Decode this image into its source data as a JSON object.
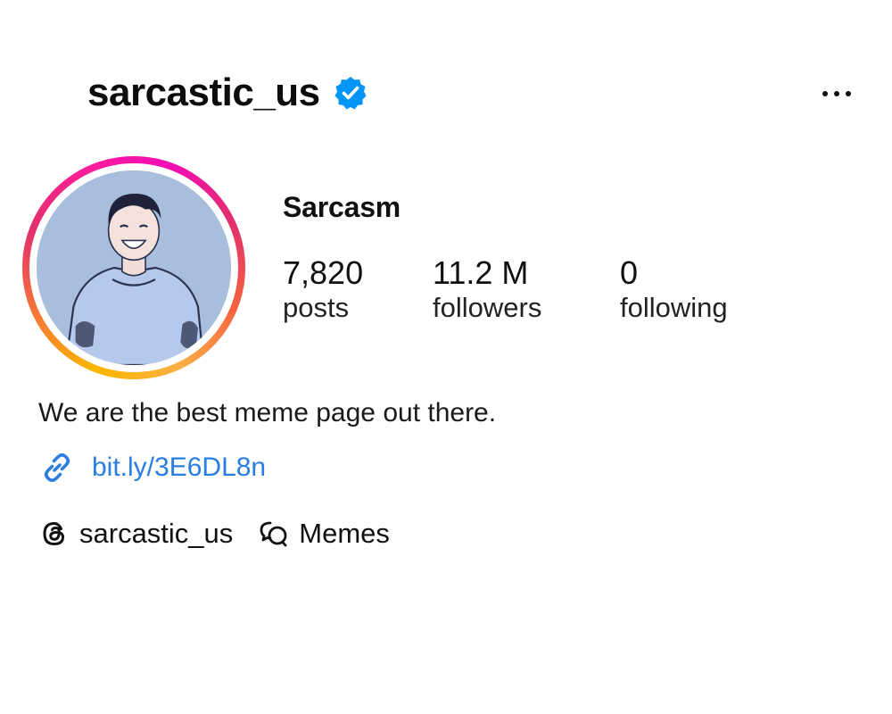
{
  "profile": {
    "username": "sarcastic_us",
    "display_name": "Sarcasm",
    "verified": true,
    "bio": "We are the best meme page out there.",
    "link": "bit.ly/3E6DL8n"
  },
  "stats": {
    "posts": {
      "value": "7,820",
      "label": "posts"
    },
    "followers": {
      "value": "11.2 M",
      "label": "followers"
    },
    "following": {
      "value": "0",
      "label": "following"
    }
  },
  "chips": {
    "threads": {
      "label": "sarcastic_us",
      "icon": "threads-icon"
    },
    "category": {
      "label": "Memes",
      "icon": "chat-bubbles-icon"
    }
  },
  "icons": {
    "verified": "verified-badge-icon",
    "more": "more-options-icon",
    "link": "link-icon"
  },
  "colors": {
    "verified_blue": "#0095f6",
    "link_blue": "#2a7de1",
    "avatar_bg": "#a9bedc"
  }
}
